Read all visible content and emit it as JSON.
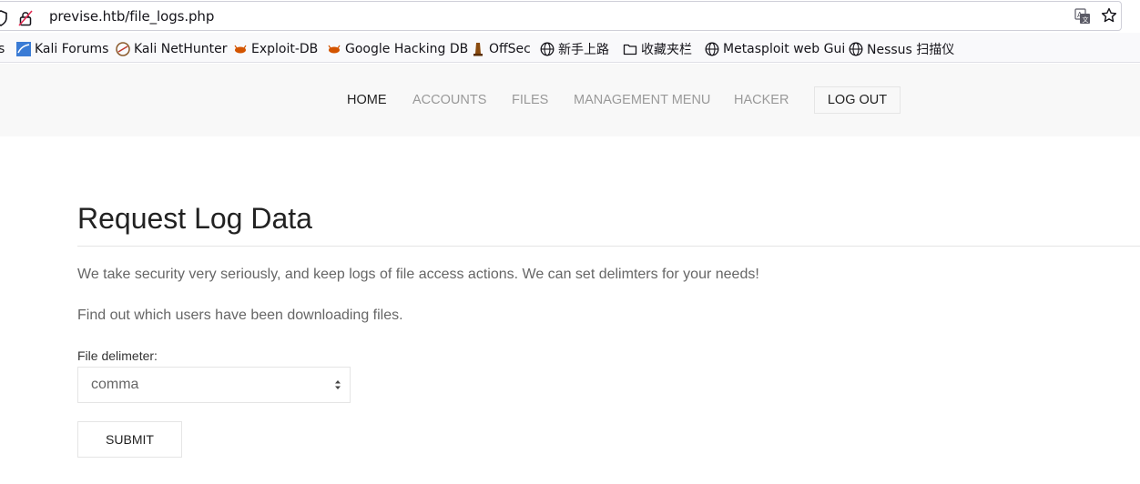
{
  "browser": {
    "url": "previse.htb/file_logs.php"
  },
  "bookmarks": [
    {
      "label": "s",
      "icon": "partial-bookmark"
    },
    {
      "label": "Kali Forums",
      "icon": "kali-forums-icon"
    },
    {
      "label": "Kali NetHunter",
      "icon": "kali-nethunter-icon"
    },
    {
      "label": "Exploit-DB",
      "icon": "exploit-db-icon"
    },
    {
      "label": "Google Hacking DB",
      "icon": "ghdb-icon"
    },
    {
      "label": "OffSec",
      "icon": "offsec-icon"
    },
    {
      "label": "新手上路",
      "icon": "globe-icon"
    },
    {
      "label": "收藏夹栏",
      "icon": "folder-icon"
    },
    {
      "label": "Metasploit web Gui",
      "icon": "globe-icon"
    },
    {
      "label": "Nessus 扫描仪",
      "icon": "globe-icon"
    }
  ],
  "nav": {
    "home": "HOME",
    "accounts": "ACCOUNTS",
    "files": "FILES",
    "management": "MANAGEMENT MENU",
    "hacker": "HACKER",
    "logout": "LOG OUT"
  },
  "content": {
    "title": "Request Log Data",
    "para1": "We take security very seriously, and keep logs of file access actions. We can set delimters for your needs!",
    "para2": "Find out which users have been downloading files.",
    "delimiter_label": "File delimeter:",
    "delimiter_value": "comma",
    "submit_label": "SUBMIT"
  },
  "colors": {
    "navbar_bg": "#f8f8f8",
    "nav_active": "#222222",
    "nav_inactive": "#999999",
    "body_text": "#666666"
  }
}
